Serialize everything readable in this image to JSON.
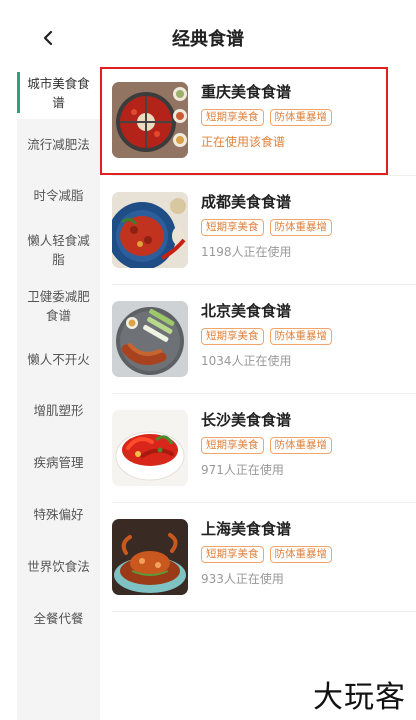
{
  "header": {
    "title": "经典食谱",
    "back_icon": "chevron-left-icon"
  },
  "sidebar": {
    "items": [
      {
        "label": "城市美食食谱",
        "active": true
      },
      {
        "label": "流行减肥法",
        "active": false
      },
      {
        "label": "时令减脂",
        "active": false
      },
      {
        "label": "懒人轻食减脂",
        "active": false
      },
      {
        "label": "卫健委减肥食谱",
        "active": false
      },
      {
        "label": "懒人不开火",
        "active": false
      },
      {
        "label": "增肌塑形",
        "active": false
      },
      {
        "label": "疾病管理",
        "active": false
      },
      {
        "label": "特殊偏好",
        "active": false
      },
      {
        "label": "世界饮食法",
        "active": false
      },
      {
        "label": "全餐代餐",
        "active": false
      }
    ]
  },
  "recipes": [
    {
      "name": "重庆美食食谱",
      "tags": [
        "短期享美食",
        "防体重暴增"
      ],
      "status": "正在使用该食谱",
      "current": true,
      "image": "hotpot-image"
    },
    {
      "name": "成都美食食谱",
      "tags": [
        "短期享美食",
        "防体重暴增"
      ],
      "status": "1198人正在使用",
      "current": false,
      "image": "chili-chicken-image"
    },
    {
      "name": "北京美食食谱",
      "tags": [
        "短期享美食",
        "防体重暴增"
      ],
      "status": "1034人正在使用",
      "current": false,
      "image": "roast-duck-image"
    },
    {
      "name": "长沙美食食谱",
      "tags": [
        "短期享美食",
        "防体重暴增"
      ],
      "status": "971人正在使用",
      "current": false,
      "image": "spicy-dish-image"
    },
    {
      "name": "上海美食食谱",
      "tags": [
        "短期享美食",
        "防体重暴增"
      ],
      "status": "933人正在使用",
      "current": false,
      "image": "crab-image"
    }
  ],
  "colors": {
    "accent": "#e0833f",
    "active_bar": "#2aa37b",
    "highlight": "#e02020"
  },
  "watermark": "大玩客"
}
